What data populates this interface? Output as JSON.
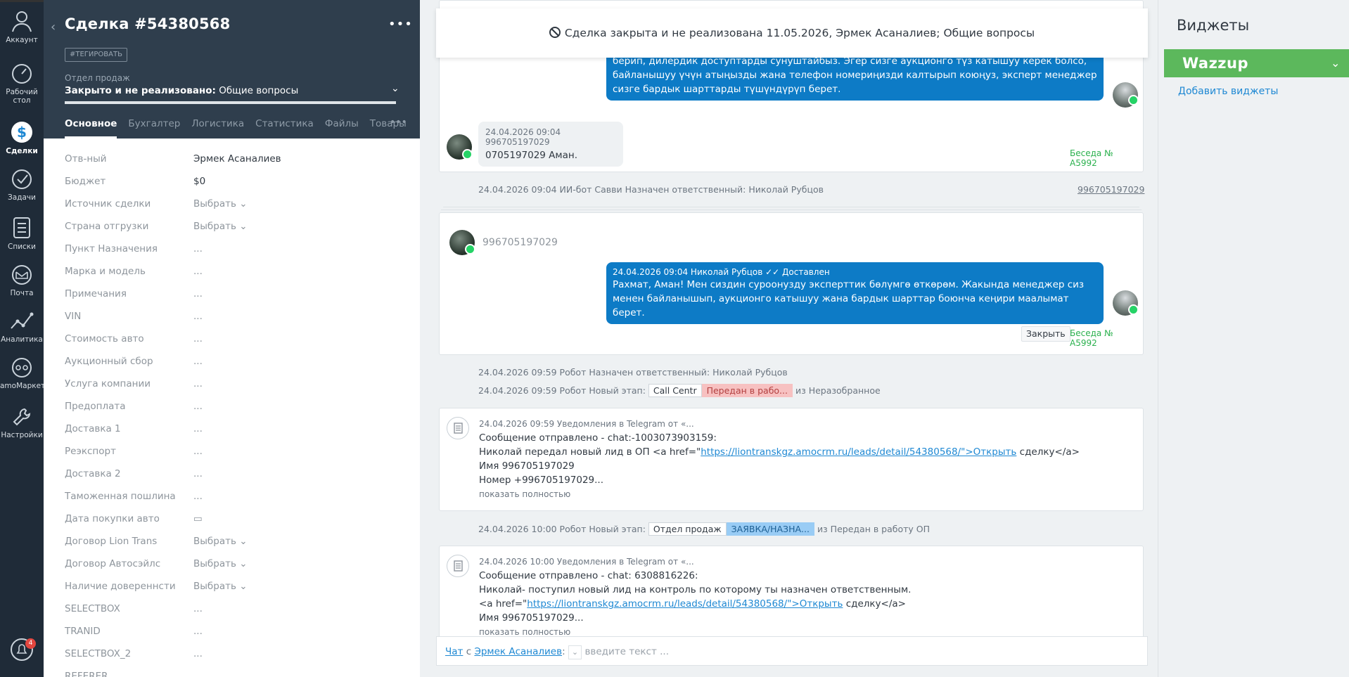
{
  "nav": {
    "items": [
      {
        "label": "Аккаунт",
        "icon": "account-icon"
      },
      {
        "label": "Рабочий\nстол",
        "icon": "dashboard-icon"
      },
      {
        "label": "Сделки",
        "icon": "deals-icon"
      },
      {
        "label": "Задачи",
        "icon": "tasks-icon"
      },
      {
        "label": "Списки",
        "icon": "lists-icon"
      },
      {
        "label": "Почта",
        "icon": "mail-icon"
      },
      {
        "label": "Аналитика",
        "icon": "analytics-icon"
      },
      {
        "label": "amoМаркет",
        "icon": "market-icon"
      },
      {
        "label": "Настройки",
        "icon": "settings-icon"
      }
    ],
    "notifications_count": "4"
  },
  "card": {
    "title": "Сделка #54380568",
    "more": "•••",
    "tag_button": "#ТЕГИРОВАТЬ",
    "pipeline": "Отдел продаж",
    "status_bold": "Закрыто и не реализовано:",
    "status_rest": "Общие вопросы",
    "tabs": [
      "Основное",
      "Бухгалтер",
      "Логистика",
      "Статистика",
      "Файлы",
      "Товары"
    ],
    "tabs_more": "•••",
    "fields": [
      {
        "label": "Отв-ный",
        "value": "Эрмек Асаналиев"
      },
      {
        "label": "Бюджет",
        "value": "$0"
      },
      {
        "label": "Источник сделки",
        "value": "Выбрать ⌄"
      },
      {
        "label": "Страна отгрузки",
        "value": "Выбрать ⌄"
      },
      {
        "label": "Пункт Назначения",
        "value": "..."
      },
      {
        "label": "Марка и модель",
        "value": "..."
      },
      {
        "label": "Примечания",
        "value": "..."
      },
      {
        "label": "VIN",
        "value": "..."
      },
      {
        "label": "Стоимость авто",
        "value": "..."
      },
      {
        "label": "Аукционный сбор",
        "value": "..."
      },
      {
        "label": "Услуга компании",
        "value": "..."
      },
      {
        "label": "Предоплата",
        "value": "..."
      },
      {
        "label": "Доставка 1",
        "value": "..."
      },
      {
        "label": "Реэкспорт",
        "value": "..."
      },
      {
        "label": "Доставка 2",
        "value": "..."
      },
      {
        "label": "Таможенная пошлина",
        "value": "..."
      },
      {
        "label": "Дата покупки авто",
        "value": "▭"
      },
      {
        "label": "Договор Lion Trans",
        "value": "Выбрать ⌄"
      },
      {
        "label": "Договор Автосэйлс",
        "value": "Выбрать ⌄"
      },
      {
        "label": "Наличие довереннсти",
        "value": "Выбрать ⌄"
      },
      {
        "label": "SELECTBOX",
        "value": "..."
      },
      {
        "label": "TRANID",
        "value": "..."
      },
      {
        "label": "SELECTBOX_2",
        "value": "..."
      },
      {
        "label": "REFERER",
        "value": ""
      }
    ]
  },
  "feed": {
    "closed_banner": "Сделка закрыта и не реализована 11.05.2026, Эрмек Асаналиев; Общие вопросы",
    "msg1_text": "берип, дилердик доступтарды сунуштайбыз. Эгер сизге аукционго түз катышуу керек болсо, байланышуу үчүн атыңызды жана телефон номериңизди калтырып коюңуз, эксперт менеджер сизге бардык шарттарды түшүндүрүп берет.",
    "msg2_meta": "24.04.2026 09:04 996705197029",
    "msg2_text": "0705197029 Аман.",
    "conversation1": "Беседа № A5992",
    "event1": "24.04.2026 09:04 ИИ-бот Савви Назначен ответственный: Николай Рубцов",
    "event1_link": "996705197029",
    "chat2_phone": "996705197029",
    "msg3_meta": "24.04.2026 09:04 Николай Рубцов",
    "msg3_status": "✓✓ Доставлен",
    "msg3_text": "Рахмат, Аман! Мен сиздин суроонуздy эксперттик бөлүмгө өткөрөм. Жакында менеджер сиз менен байланышып, аукционго катышуу жана бардык шарттар боюнча кеңири маалымат берет.",
    "close_button": "Закрыть",
    "conversation2": "Беседа № A5992",
    "event2": "24.04.2026 09:59 Робот Назначен ответственный: Николай Рубцов",
    "event3_prefix": "24.04.2026 09:59 Робот Новый этап:",
    "event3_tag1": "Call Centr",
    "event3_tag2": "Передан в рабо...",
    "event3_suffix": "из Неразобранное",
    "note1_meta": "24.04.2026 09:59 Уведомления в Telegram от «...",
    "note1_l1": "Сообщение отправлено - chat:-1003073903159:",
    "note1_l2a": "Николай передал новый лид в ОП <a href=\"",
    "note1_link": "https://liontranskgz.amocrm.ru/leads/detail/54380568/\">Открыть",
    "note1_l2b": " сделку</a>",
    "note1_l3": "Имя 996705197029",
    "note1_l4": "Номер +996705197029...",
    "note1_more": "показать полностью",
    "event4_prefix": "24.04.2026 10:00 Робот Новый этап:",
    "event4_tag1": "Отдел продаж",
    "event4_tag2": "ЗАЯВКА/НАЗНА...",
    "event4_suffix": "из Передан в работу ОП",
    "note2_meta": "24.04.2026 10:00 Уведомления в Telegram от «...",
    "note2_l1": "Сообщение отправлено - chat: 6308816226:",
    "note2_l2": "Николай- поступил новый лид на контроль по которому ты назначен ответственным.",
    "note2_l3a": "<a href=\"",
    "note2_link": "https://liontranskgz.amocrm.ru/leads/detail/54380568/\">Открыть",
    "note2_l3b": " сделку</a>",
    "note2_l4": "Имя 996705197029...",
    "note2_more": "показать полностью",
    "chat_label": "Чат",
    "chat_with": "с",
    "chat_user": "Эрмек Асаналиев",
    "chat_placeholder": "введите текст ..."
  },
  "widgets": {
    "title": "Виджеты",
    "wazzup": "Wazzup",
    "add": "Добавить виджеты"
  }
}
